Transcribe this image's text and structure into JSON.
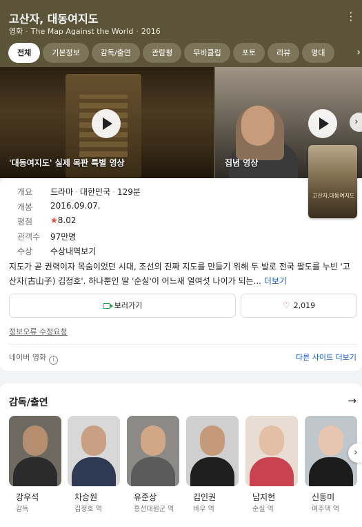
{
  "header": {
    "title": "고산자, 대동여지도",
    "category": "영화",
    "english_title": "The Map Against the World",
    "year": "2016"
  },
  "tabs": [
    {
      "label": "전체",
      "active": true
    },
    {
      "label": "기본정보"
    },
    {
      "label": "감독/출연"
    },
    {
      "label": "관람평"
    },
    {
      "label": "무비클립"
    },
    {
      "label": "포토"
    },
    {
      "label": "리뷰"
    },
    {
      "label": "명대"
    }
  ],
  "videos": [
    {
      "caption": "'대동여지도' 실제 목판 특별 영상"
    },
    {
      "caption": "집념 영상"
    }
  ],
  "info": {
    "overview_label": "개요",
    "genre": "드라마",
    "country": "대한민국",
    "runtime": "129분",
    "release_label": "개봉",
    "release_date": "2016.09.07.",
    "rating_label": "평점",
    "rating": "8.02",
    "audience_label": "관객수",
    "audience": "97만명",
    "award_label": "수상",
    "award_link": "수상내역보기",
    "poster_text": "고산자,대동여지도"
  },
  "synopsis": {
    "text": "지도가 곧 권력이자 목숨이었던 시대, 조선의 진짜 지도를 만들기 위해 두 발로 전국 팔도를 누빈 '고산자(古山子) 김정호'. 하나뿐인 딸 '순실'이 어느새 열여섯 나이가 되는...",
    "more": "더보기"
  },
  "actions": {
    "watch_label": "보러가기",
    "like_count": "2,019"
  },
  "footer": {
    "report_label": "정보오류 수정요청",
    "source_label": "네이버 영화",
    "other_sites_label": "다른 사이트 더보기"
  },
  "cast": {
    "title": "감독/출연",
    "people": [
      {
        "name": "강우석",
        "role": "감독"
      },
      {
        "name": "차승원",
        "role": "김정호 역"
      },
      {
        "name": "유준상",
        "role": "흥선대원군 역"
      },
      {
        "name": "김인권",
        "role": "바우 역"
      },
      {
        "name": "남지현",
        "role": "순실 역"
      },
      {
        "name": "신동미",
        "role": "여주댁 역"
      }
    ]
  },
  "colors": {
    "header_bg": "#5b5438",
    "link": "#1b5fc9",
    "star": "#e8453c",
    "watch_icon": "#1aa34a"
  }
}
